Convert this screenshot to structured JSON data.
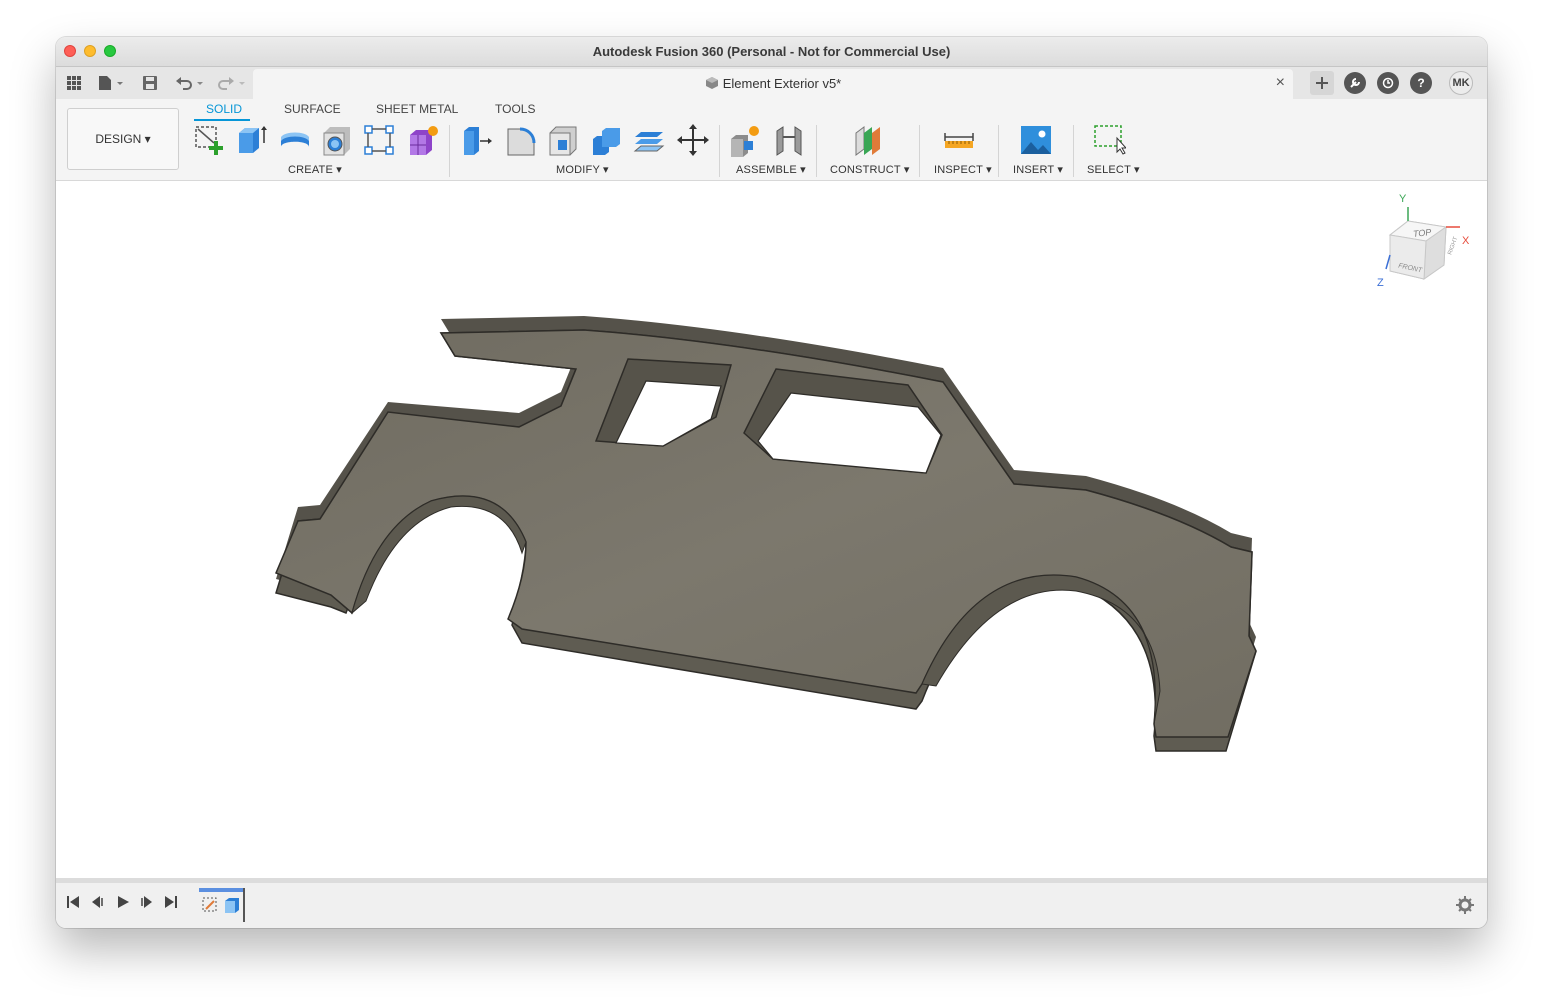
{
  "window": {
    "title": "Autodesk Fusion 360 (Personal - Not for Commercial Use)"
  },
  "tabbar": {
    "icons": [
      "grid-icon",
      "file-icon",
      "save-icon",
      "undo-icon",
      "redo-icon"
    ],
    "document_title": "Element Exterior v5*",
    "close_glyph": "×",
    "user_initials": "MK"
  },
  "toolbar": {
    "workspace_button": "DESIGN ▾",
    "tabs": [
      "SOLID",
      "SURFACE",
      "SHEET METAL",
      "TOOLS"
    ],
    "active_tab": "SOLID",
    "groups": {
      "create": "CREATE ▾",
      "modify": "MODIFY ▾",
      "assemble": "ASSEMBLE ▾",
      "construct": "CONSTRUCT ▾",
      "inspect": "INSPECT ▾",
      "insert": "INSERT ▾",
      "select": "SELECT ▾"
    }
  },
  "viewcube": {
    "top": "TOP",
    "front": "FRONT",
    "right": "RIGHT",
    "axis_x": "X",
    "axis_y": "Y",
    "axis_z": "Z"
  },
  "colors": {
    "accent": "#0696d7",
    "model_face": "#7a766a",
    "model_side": "#5f5c52"
  }
}
